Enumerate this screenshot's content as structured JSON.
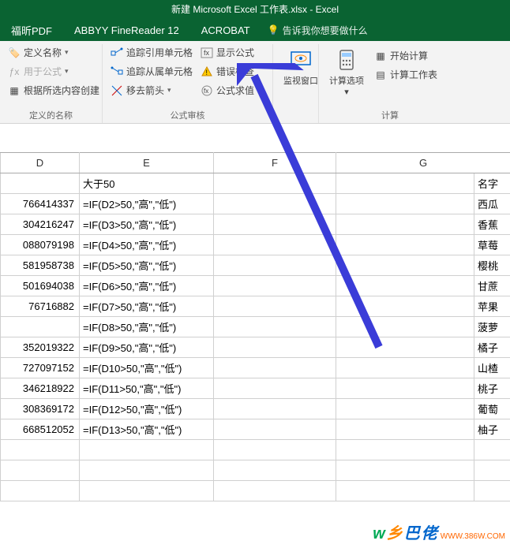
{
  "title": "新建 Microsoft Excel 工作表.xlsx - Excel",
  "tabs": {
    "foxit": "福昕PDF",
    "abbyy": "ABBYY FineReader 12",
    "acrobat": "ACROBAT"
  },
  "tell_me": "告诉我你想要做什么",
  "ribbon": {
    "names_group": {
      "define_name": "定义名称",
      "use_in_formula": "用于公式",
      "create_from_sel": "根据所选内容创建",
      "label": "定义的名称"
    },
    "audit_group": {
      "trace_precedents": "追踪引用单元格",
      "trace_dependents": "追踪从属单元格",
      "remove_arrows": "移去箭头",
      "show_formulas": "显示公式",
      "error_check": "错误检查",
      "evaluate": "公式求值",
      "label": "公式审核"
    },
    "watch": "监视窗口",
    "calc_group": {
      "calc_options": "计算选项",
      "calc_now": "开始计算",
      "calc_sheet": "计算工作表",
      "label": "计算"
    }
  },
  "columns": {
    "D": "D",
    "E": "E",
    "F": "F",
    "G": "G"
  },
  "header_E": "大于50",
  "header_G": "名字",
  "rows": [
    {
      "d": "766414337",
      "e": "=IF(D2>50,\"高\",\"低\")",
      "g": "西瓜"
    },
    {
      "d": "304216247",
      "e": "=IF(D3>50,\"高\",\"低\")",
      "g": "香蕉"
    },
    {
      "d": "088079198",
      "e": "=IF(D4>50,\"高\",\"低\")",
      "g": "草莓"
    },
    {
      "d": "581958738",
      "e": "=IF(D5>50,\"高\",\"低\")",
      "g": "樱桃"
    },
    {
      "d": "501694038",
      "e": "=IF(D6>50,\"高\",\"低\")",
      "g": "甘蔗"
    },
    {
      "d": "76716882",
      "e": "=IF(D7>50,\"高\",\"低\")",
      "g": "苹果"
    },
    {
      "d": "",
      "e": "=IF(D8>50,\"高\",\"低\")",
      "g": "菠萝"
    },
    {
      "d": "352019322",
      "e": "=IF(D9>50,\"高\",\"低\")",
      "g": "橘子"
    },
    {
      "d": "727097152",
      "e": "=IF(D10>50,\"高\",\"低\")",
      "g": "山楂"
    },
    {
      "d": "346218922",
      "e": "=IF(D11>50,\"高\",\"低\")",
      "g": "桃子"
    },
    {
      "d": "308369172",
      "e": "=IF(D12>50,\"高\",\"低\")",
      "g": "葡萄"
    },
    {
      "d": "668512052",
      "e": "=IF(D13>50,\"高\",\"低\")",
      "g": "柚子"
    }
  ],
  "watermark": {
    "t1": "ᴡ",
    "t2": "乡",
    "t3": "巴",
    "t4": "佬",
    "url": "WWW.386W.COM"
  }
}
